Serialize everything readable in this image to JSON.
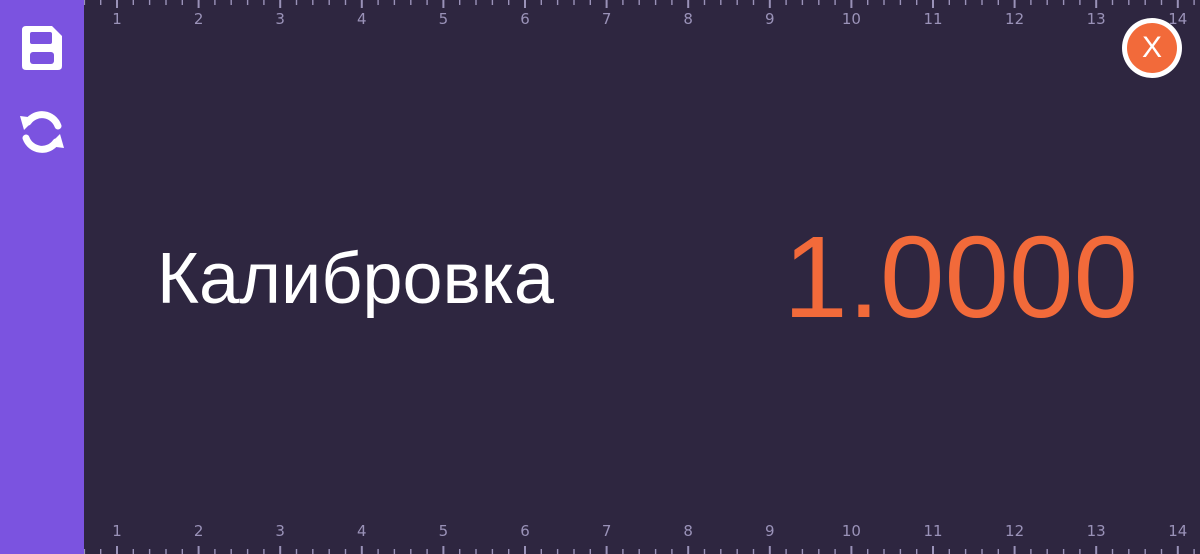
{
  "sidebar": {
    "save_icon": "save-icon",
    "sync_icon": "sync-icon"
  },
  "ruler": {
    "labels": [
      "1",
      "2",
      "3",
      "4",
      "5",
      "6",
      "7",
      "8",
      "9",
      "10",
      "11",
      "12",
      "13",
      "14"
    ]
  },
  "main": {
    "title": "Калибровка",
    "value": "1.0000"
  },
  "close_button": {
    "label": "X"
  },
  "colors": {
    "sidebar": "#7b53e0",
    "background": "#2e2640",
    "accent": "#f26a3a",
    "close": "#f26a3a",
    "ruler": "#9a92b8",
    "text": "#ffffff"
  }
}
